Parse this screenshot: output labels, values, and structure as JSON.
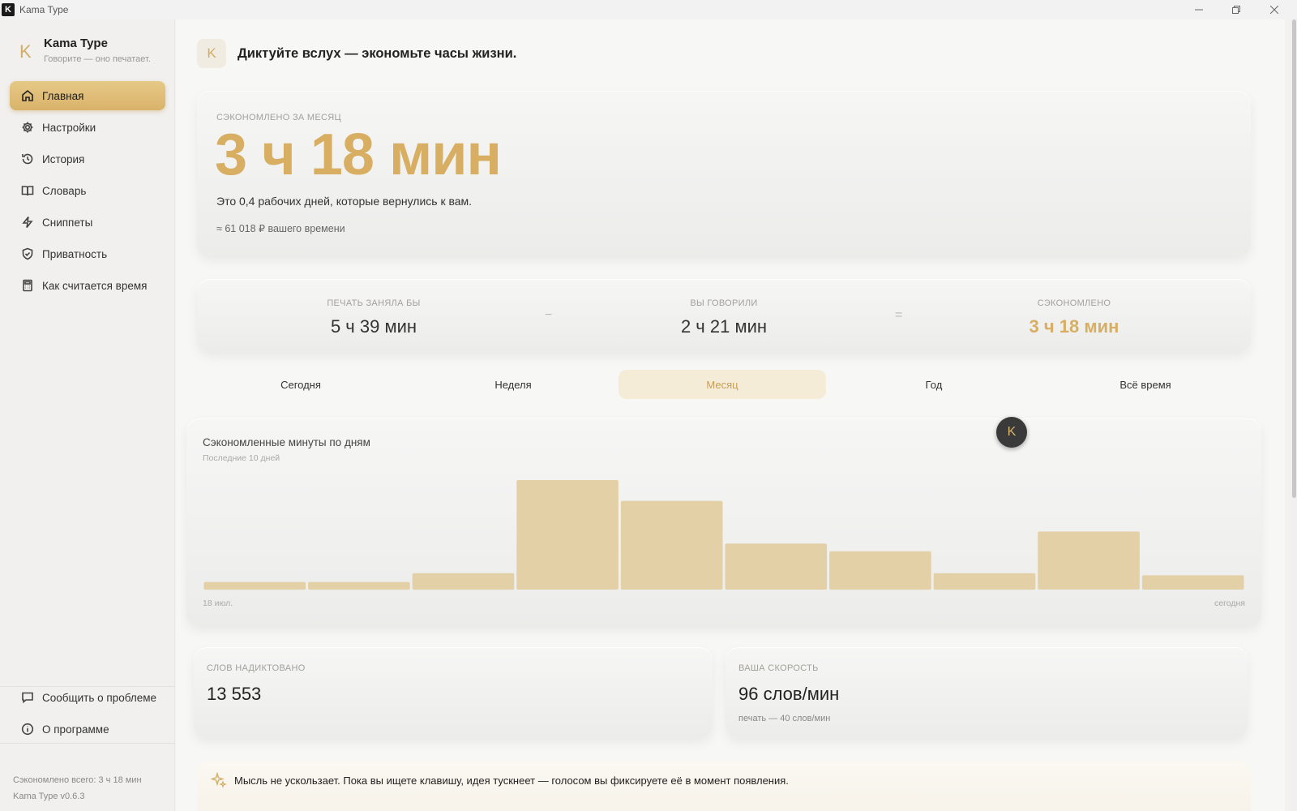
{
  "window": {
    "title": "Kama Type",
    "logo": "K"
  },
  "sidebar": {
    "brand": {
      "logo": "K",
      "name": "Kama Type",
      "tagline": "Говорите — оно печатает."
    },
    "items": [
      {
        "label": "Главная",
        "icon": "home-icon"
      },
      {
        "label": "Настройки",
        "icon": "gear-icon"
      },
      {
        "label": "История",
        "icon": "history-icon"
      },
      {
        "label": "Словарь",
        "icon": "book-icon"
      },
      {
        "label": "Сниппеты",
        "icon": "lightning-icon"
      },
      {
        "label": "Приватность",
        "icon": "shield-icon"
      },
      {
        "label": "Как считается время",
        "icon": "calculator-icon"
      }
    ],
    "bottom": [
      {
        "label": "Сообщить о проблеме",
        "icon": "message-icon"
      },
      {
        "label": "О программе",
        "icon": "info-icon"
      }
    ],
    "footer": {
      "total": "Сэкономлено всего: 3 ч 18 мин",
      "version": "Kama Type v0.6.3"
    }
  },
  "header": {
    "logo": "K",
    "title": "Диктуйте вслух — экономьте часы жизни."
  },
  "hero": {
    "label": "Сэкономлено за месяц",
    "value": "3 ч 18 мин",
    "description": "Это 0,4 рабочих дней, которые вернулись к вам.",
    "money": "≈ 61 018 ₽ вашего времени"
  },
  "compare": {
    "typing": {
      "label": "Печать заняла бы",
      "value": "5 ч 39 мин"
    },
    "minus": "−",
    "spoken": {
      "label": "Вы говорили",
      "value": "2 ч 21 мин"
    },
    "equals": "=",
    "saved": {
      "label": "Сэкономлено",
      "value": "3 ч 18 мин"
    }
  },
  "tabs": [
    {
      "label": "Сегодня",
      "active": false
    },
    {
      "label": "Неделя",
      "active": false
    },
    {
      "label": "Месяц",
      "active": true
    },
    {
      "label": "Год",
      "active": false
    },
    {
      "label": "Всё время",
      "active": false
    }
  ],
  "chart": {
    "title": "Сэкономленные минуты по дням",
    "subtitle": "Последние 10 дней",
    "start_label": "18 июл.",
    "end_label": "сегодня",
    "bar_color": "#e4d0a6"
  },
  "chart_data": {
    "type": "bar",
    "title": "Сэкономленные минуты по дням",
    "subtitle": "Последние 10 дней",
    "categories": [
      "18 июл.",
      "",
      "",
      "",
      "",
      "",
      "",
      "",
      "",
      "сегодня"
    ],
    "values": [
      7,
      7,
      15,
      100,
      81,
      42,
      35,
      15,
      53,
      13
    ],
    "ylim": [
      0,
      100
    ],
    "grid": false
  },
  "floating_badge": {
    "logo": "K"
  },
  "stats": {
    "words": {
      "label": "Слов надиктовано",
      "value": "13 553"
    },
    "speed": {
      "label": "Ваша скорость",
      "value": "96 слов/мин",
      "sub": "печать — 40 слов/мин"
    }
  },
  "tip": {
    "icon": "sparkle-icon",
    "text": "Мысль не ускользает. Пока вы ищете клавишу, идея тускнеет — голосом вы фиксируете её в момент появления."
  },
  "colors": {
    "accent": "#d7ae62",
    "active_tab_bg": "#f5ecd8"
  }
}
